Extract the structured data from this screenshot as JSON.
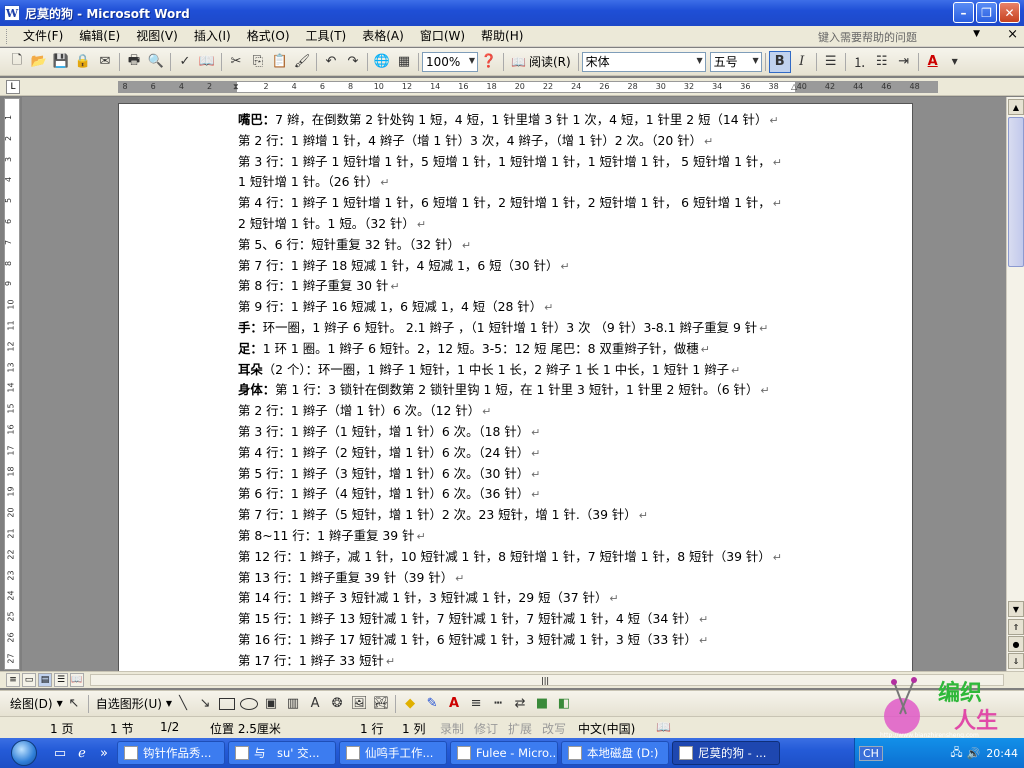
{
  "window": {
    "title": "尼莫的狗 - Microsoft Word",
    "app_icon": "W",
    "minimize": "–",
    "maximize": "❐",
    "close": "✕"
  },
  "menubar": {
    "items": [
      "文件(F)",
      "编辑(E)",
      "视图(V)",
      "插入(I)",
      "格式(O)",
      "工具(T)",
      "表格(A)",
      "窗口(W)",
      "帮助(H)"
    ],
    "help_placeholder": "键入需要帮助的问题",
    "doc_close": "×"
  },
  "toolbar": {
    "zoom": "100%",
    "read_label": "阅读(R)",
    "font_name": "宋体",
    "font_size": "五号",
    "bold": "B",
    "italic": "I",
    "font_color_letter": "A"
  },
  "ruler": {
    "h_ticks": [
      "8",
      "6",
      "4",
      "2",
      "",
      "2",
      "4",
      "6",
      "8",
      "10",
      "12",
      "14",
      "16",
      "18",
      "20",
      "22",
      "24",
      "26",
      "28",
      "30",
      "32",
      "34",
      "36",
      "38",
      "40",
      "42",
      "44",
      "46",
      "48"
    ],
    "v_ticks": [
      "1",
      "2",
      "3",
      "4",
      "5",
      "6",
      "7",
      "8",
      "9",
      "10",
      "11",
      "12",
      "13",
      "14",
      "15",
      "16",
      "17",
      "18",
      "19",
      "20",
      "21",
      "22",
      "23",
      "24",
      "25",
      "26",
      "27"
    ]
  },
  "document": {
    "paragraph_mark": "↵",
    "lines": [
      {
        "bold": "嘴巴：",
        "text": "7 辫，在倒数第 2 针处钩 1 短，4 短，1 针里增 3 针 1 次，4 短，1 针里 2 短（14 针）"
      },
      {
        "bold": "",
        "text": "第 2 行：1 辫增 1 针，4 辫子（增 1 针）3 次，4 辫子，（增 1 针）2 次。（20 针）"
      },
      {
        "bold": "",
        "text": "第 3 行：1 辫子 1 短针增 1 针，5 短增 1 针，1 短针增 1 针，1 短针增 1 针，   5 短针增 1 针，"
      },
      {
        "bold": "",
        "text": "1 短针增 1 针。（26 针）"
      },
      {
        "bold": "",
        "text": "第 4 行：1 辫子 1 短针增 1 针，6 短增 1 针，2 短针增 1 针，2 短针增 1 针，   6 短针增 1 针，"
      },
      {
        "bold": "",
        "text": "2 短针增 1 针。1 短。（32 针）"
      },
      {
        "bold": "",
        "text": "第 5、6 行：短针重复 32 针。（32 针）"
      },
      {
        "bold": "",
        "text": "第 7 行：1 辫子 18 短减 1 针，4 短减 1，6 短（30 针）"
      },
      {
        "bold": "",
        "text": "第 8 行：1 辫子重复 30 针"
      },
      {
        "bold": "",
        "text": "第 9 行：1 辫子 16 短减 1，6 短减 1，4 短（28 针）"
      },
      {
        "bold": "手：",
        "text": "环一圈，1 辫子 6 短针。 2.1 辫子 ，（1 短针增 1 针）3 次 （9 针）3-8.1 辫子重复 9 针"
      },
      {
        "bold": "足：",
        "text": "1 环 1 圈。1 辫子 6 短针。2，12 短。3-5：12 短  尾巴：8 双重辫子针，做穗"
      },
      {
        "bold": "耳朵",
        "text": "（2 个）：环一圈，1 辫子 1 短针，1 中长 1 长，2 辫子 1 长 1 中长，1 短针 1 辫子"
      },
      {
        "bold": "身体：",
        "text": "第 1 行：3 锁针在倒数第 2 锁针里钩 1 短，在 1 针里 3 短针，1 针里 2 短针。（6 针）"
      },
      {
        "bold": "",
        "text": "第 2 行：1 辫子（增 1 针）6 次。（12 针）"
      },
      {
        "bold": "",
        "text": "第 3 行：1 辫子（1 短针，增 1 针）6 次。（18 针）"
      },
      {
        "bold": "",
        "text": "第 4 行：1 辫子（2 短针，增 1 针）6 次。（24 针）"
      },
      {
        "bold": "",
        "text": "第 5 行：1 辫子（3 短针，增 1 针）6 次。（30 针）"
      },
      {
        "bold": "",
        "text": "第 6 行：1 辫子（4 短针，增 1 针）6 次。（36 针）"
      },
      {
        "bold": "",
        "text": "第 7 行：1 辫子（5 短针，增 1 针）2 次。23 短针，增 1 针.（39 针）"
      },
      {
        "bold": "",
        "text": "第 8~11 行：1 辫子重复 39 针"
      },
      {
        "bold": "",
        "text": "第 12 行：1 辫子，减 1 针，10 短针减 1 针，8 短针增 1 针，7 短针增 1 针，8 短针（39 针）"
      },
      {
        "bold": "",
        "text": "第 13 行：1 辫子重复 39 针（39 针）"
      },
      {
        "bold": "",
        "text": "第 14 行：1 辫子 3 短针减 1 针，3 短针减 1 针，29 短（37 针）"
      },
      {
        "bold": "",
        "text": "第 15 行：1 辫子 13 短针减 1 针，7 短针减 1 针，7 短针减 1 针，4 短（34 针）"
      },
      {
        "bold": "",
        "text": "第 16 行：1 辫子 17 短针减 1 针，6 短针减 1 针，3 短针减 1 针，3 短（33 针）"
      },
      {
        "bold": "",
        "text": "第 17 行：1 辫子 33 短针"
      }
    ]
  },
  "drawbar": {
    "draw_label": "绘图(D)",
    "autoshape_label": "自选图形(U)"
  },
  "statusbar": {
    "page": "1 页",
    "section": "1 节",
    "page_of": "1/2",
    "position": "位置 2.5厘米",
    "line": "1 行",
    "column": "1 列",
    "rec": "录制",
    "trk": "修订",
    "ext": "扩展",
    "ovr": "改写",
    "language": "中文(中国)"
  },
  "logo": {
    "line1": "编织",
    "line2": "人生",
    "url": "http://www.bianzhirensheng.com"
  },
  "taskbar": {
    "tasks": [
      "钩针作品秀...",
      "与　su' 交...",
      "仙鸣手工作...",
      "Fulee - Micro...",
      "本地磁盘 (D:)",
      "尼莫的狗 - ..."
    ],
    "active_index": 5,
    "input_method": "CH",
    "clock": "20:44"
  }
}
